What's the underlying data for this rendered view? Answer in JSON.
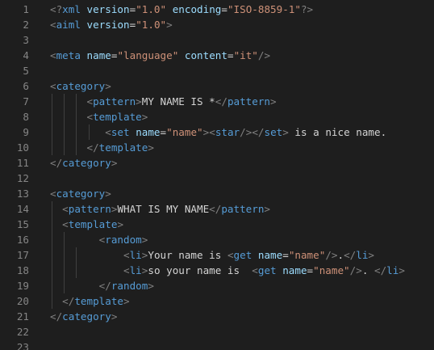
{
  "editor": {
    "colors": {
      "background": "#1e1e1e",
      "line_number": "#858585",
      "punctuation": "#808080",
      "tag": "#569cd6",
      "attribute": "#9cdcfe",
      "string": "#ce9178",
      "text": "#d4d4d4",
      "indent_guide": "#404040"
    },
    "lines": [
      {
        "number": "1",
        "indent_guides": 0,
        "tokens": [
          {
            "text": "<?",
            "kind": "p"
          },
          {
            "text": "xml",
            "kind": "t"
          },
          {
            "text": " ",
            "kind": "x"
          },
          {
            "text": "version",
            "kind": "a"
          },
          {
            "text": "=",
            "kind": "x"
          },
          {
            "text": "\"1.0\"",
            "kind": "s"
          },
          {
            "text": " ",
            "kind": "x"
          },
          {
            "text": "encoding",
            "kind": "a"
          },
          {
            "text": "=",
            "kind": "x"
          },
          {
            "text": "\"ISO-8859-1\"",
            "kind": "s"
          },
          {
            "text": "?>",
            "kind": "p"
          }
        ]
      },
      {
        "number": "2",
        "indent_guides": 0,
        "tokens": [
          {
            "text": "<",
            "kind": "p"
          },
          {
            "text": "aiml",
            "kind": "t"
          },
          {
            "text": " ",
            "kind": "x"
          },
          {
            "text": "version",
            "kind": "a"
          },
          {
            "text": "=",
            "kind": "x"
          },
          {
            "text": "\"1.0\"",
            "kind": "s"
          },
          {
            "text": ">",
            "kind": "p"
          }
        ]
      },
      {
        "number": "3",
        "indent_guides": 0,
        "tokens": []
      },
      {
        "number": "4",
        "indent_guides": 0,
        "tokens": [
          {
            "text": "<",
            "kind": "p"
          },
          {
            "text": "meta",
            "kind": "t"
          },
          {
            "text": " ",
            "kind": "x"
          },
          {
            "text": "name",
            "kind": "a"
          },
          {
            "text": "=",
            "kind": "x"
          },
          {
            "text": "\"language\"",
            "kind": "s"
          },
          {
            "text": " ",
            "kind": "x"
          },
          {
            "text": "content",
            "kind": "a"
          },
          {
            "text": "=",
            "kind": "x"
          },
          {
            "text": "\"it\"",
            "kind": "s"
          },
          {
            "text": "/>",
            "kind": "p"
          }
        ]
      },
      {
        "number": "5",
        "indent_guides": 0,
        "tokens": []
      },
      {
        "number": "6",
        "indent_guides": 0,
        "tokens": [
          {
            "text": "<",
            "kind": "p"
          },
          {
            "text": "category",
            "kind": "t"
          },
          {
            "text": ">",
            "kind": "p"
          }
        ]
      },
      {
        "number": "7",
        "indent_guides": 3,
        "tokens": [
          {
            "text": "      ",
            "kind": "x"
          },
          {
            "text": "<",
            "kind": "p"
          },
          {
            "text": "pattern",
            "kind": "t"
          },
          {
            "text": ">",
            "kind": "p"
          },
          {
            "text": "MY NAME IS *",
            "kind": "x"
          },
          {
            "text": "</",
            "kind": "p"
          },
          {
            "text": "pattern",
            "kind": "t"
          },
          {
            "text": ">",
            "kind": "p"
          }
        ]
      },
      {
        "number": "8",
        "indent_guides": 3,
        "tokens": [
          {
            "text": "      ",
            "kind": "x"
          },
          {
            "text": "<",
            "kind": "p"
          },
          {
            "text": "template",
            "kind": "t"
          },
          {
            "text": ">",
            "kind": "p"
          }
        ]
      },
      {
        "number": "9",
        "indent_guides": 4,
        "tokens": [
          {
            "text": "         ",
            "kind": "x"
          },
          {
            "text": "<",
            "kind": "p"
          },
          {
            "text": "set",
            "kind": "t"
          },
          {
            "text": " ",
            "kind": "x"
          },
          {
            "text": "name",
            "kind": "a"
          },
          {
            "text": "=",
            "kind": "x"
          },
          {
            "text": "\"name\"",
            "kind": "s"
          },
          {
            "text": ">",
            "kind": "p"
          },
          {
            "text": "<",
            "kind": "p"
          },
          {
            "text": "star",
            "kind": "t"
          },
          {
            "text": "/>",
            "kind": "p"
          },
          {
            "text": "</",
            "kind": "p"
          },
          {
            "text": "set",
            "kind": "t"
          },
          {
            "text": ">",
            "kind": "p"
          },
          {
            "text": " is a nice name.",
            "kind": "x"
          }
        ]
      },
      {
        "number": "10",
        "indent_guides": 3,
        "tokens": [
          {
            "text": "      ",
            "kind": "x"
          },
          {
            "text": "</",
            "kind": "p"
          },
          {
            "text": "template",
            "kind": "t"
          },
          {
            "text": ">",
            "kind": "p"
          }
        ]
      },
      {
        "number": "11",
        "indent_guides": 0,
        "tokens": [
          {
            "text": "</",
            "kind": "p"
          },
          {
            "text": "category",
            "kind": "t"
          },
          {
            "text": ">",
            "kind": "p"
          }
        ]
      },
      {
        "number": "12",
        "indent_guides": 0,
        "tokens": []
      },
      {
        "number": "13",
        "indent_guides": 0,
        "tokens": [
          {
            "text": "<",
            "kind": "p"
          },
          {
            "text": "category",
            "kind": "t"
          },
          {
            "text": ">",
            "kind": "p"
          }
        ]
      },
      {
        "number": "14",
        "indent_guides": 1,
        "tokens": [
          {
            "text": "  ",
            "kind": "x"
          },
          {
            "text": "<",
            "kind": "p"
          },
          {
            "text": "pattern",
            "kind": "t"
          },
          {
            "text": ">",
            "kind": "p"
          },
          {
            "text": "WHAT IS MY NAME",
            "kind": "x"
          },
          {
            "text": "</",
            "kind": "p"
          },
          {
            "text": "pattern",
            "kind": "t"
          },
          {
            "text": ">",
            "kind": "p"
          }
        ]
      },
      {
        "number": "15",
        "indent_guides": 1,
        "tokens": [
          {
            "text": "  ",
            "kind": "x"
          },
          {
            "text": "<",
            "kind": "p"
          },
          {
            "text": "template",
            "kind": "t"
          },
          {
            "text": ">",
            "kind": "p"
          }
        ]
      },
      {
        "number": "16",
        "indent_guides": 2,
        "tokens": [
          {
            "text": "        ",
            "kind": "x"
          },
          {
            "text": "<",
            "kind": "p"
          },
          {
            "text": "random",
            "kind": "t"
          },
          {
            "text": ">",
            "kind": "p"
          }
        ]
      },
      {
        "number": "17",
        "indent_guides": 3,
        "tokens": [
          {
            "text": "            ",
            "kind": "x"
          },
          {
            "text": "<",
            "kind": "p"
          },
          {
            "text": "li",
            "kind": "t"
          },
          {
            "text": ">",
            "kind": "p"
          },
          {
            "text": "Your name is ",
            "kind": "x"
          },
          {
            "text": "<",
            "kind": "p"
          },
          {
            "text": "get",
            "kind": "t"
          },
          {
            "text": " ",
            "kind": "x"
          },
          {
            "text": "name",
            "kind": "a"
          },
          {
            "text": "=",
            "kind": "x"
          },
          {
            "text": "\"name\"",
            "kind": "s"
          },
          {
            "text": "/>",
            "kind": "p"
          },
          {
            "text": ".",
            "kind": "x"
          },
          {
            "text": "</",
            "kind": "p"
          },
          {
            "text": "li",
            "kind": "t"
          },
          {
            "text": ">",
            "kind": "p"
          }
        ]
      },
      {
        "number": "18",
        "indent_guides": 3,
        "tokens": [
          {
            "text": "            ",
            "kind": "x"
          },
          {
            "text": "<",
            "kind": "p"
          },
          {
            "text": "li",
            "kind": "t"
          },
          {
            "text": ">",
            "kind": "p"
          },
          {
            "text": "so your name is  ",
            "kind": "x"
          },
          {
            "text": "<",
            "kind": "p"
          },
          {
            "text": "get",
            "kind": "t"
          },
          {
            "text": " ",
            "kind": "x"
          },
          {
            "text": "name",
            "kind": "a"
          },
          {
            "text": "=",
            "kind": "x"
          },
          {
            "text": "\"name\"",
            "kind": "s"
          },
          {
            "text": "/>",
            "kind": "p"
          },
          {
            "text": ". ",
            "kind": "x"
          },
          {
            "text": "</",
            "kind": "p"
          },
          {
            "text": "li",
            "kind": "t"
          },
          {
            "text": ">",
            "kind": "p"
          }
        ]
      },
      {
        "number": "19",
        "indent_guides": 2,
        "tokens": [
          {
            "text": "        ",
            "kind": "x"
          },
          {
            "text": "</",
            "kind": "p"
          },
          {
            "text": "random",
            "kind": "t"
          },
          {
            "text": ">",
            "kind": "p"
          }
        ]
      },
      {
        "number": "20",
        "indent_guides": 1,
        "tokens": [
          {
            "text": "  ",
            "kind": "x"
          },
          {
            "text": "</",
            "kind": "p"
          },
          {
            "text": "template",
            "kind": "t"
          },
          {
            "text": ">",
            "kind": "p"
          }
        ]
      },
      {
        "number": "21",
        "indent_guides": 0,
        "tokens": [
          {
            "text": "</",
            "kind": "p"
          },
          {
            "text": "category",
            "kind": "t"
          },
          {
            "text": ">",
            "kind": "p"
          }
        ]
      },
      {
        "number": "22",
        "indent_guides": 0,
        "tokens": []
      },
      {
        "number": "23",
        "indent_guides": 0,
        "tokens": []
      }
    ]
  }
}
